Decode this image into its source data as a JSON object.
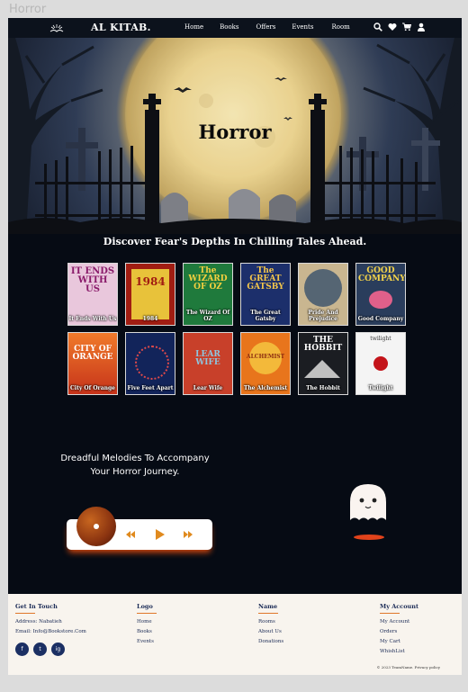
{
  "window_title": "Horror",
  "navbar": {
    "brand": "AL KITAB.",
    "links": [
      "Home",
      "Books",
      "Offers",
      "Events",
      "Room"
    ],
    "icons": [
      "search-icon",
      "heart-icon",
      "cart-icon",
      "user-icon"
    ]
  },
  "hero": {
    "title": "Horror"
  },
  "subtitle": "Discover Fear's Depths In Chilling Tales Ahead.",
  "books": [
    {
      "title": "It Ends With Us",
      "cover_text": "IT ENDS WITH US"
    },
    {
      "title": "1984",
      "cover_text": "1984"
    },
    {
      "title": "The Wizard Of OZ",
      "cover_text": "The WIZARD OF OZ"
    },
    {
      "title": "The Great Gatsby",
      "cover_text": "The GREAT GATSBY"
    },
    {
      "title": "Pride And Prejudice",
      "cover_text": ""
    },
    {
      "title": "Good Company",
      "cover_text": "GOOD COMPANY"
    },
    {
      "title": "City Of Orange",
      "cover_text": "CITY OF ORANGE"
    },
    {
      "title": "Five Feet Apart",
      "cover_text": ""
    },
    {
      "title": "Lear Wife",
      "cover_text": "LEAR WIFE"
    },
    {
      "title": "The Alchemist",
      "cover_text": "ALCHEMIST"
    },
    {
      "title": "The Hobbit",
      "cover_text": "THE HOBBIT"
    },
    {
      "title": "Twilight",
      "cover_text": "twilight"
    }
  ],
  "music": {
    "heading": "Dreadful Melodies To Accompany Your Horror Journey."
  },
  "footer": {
    "col1": {
      "title": "Get In Touch",
      "address": "Address: Nabatieh",
      "email": "Email: Info@Bookstore.Com"
    },
    "col2": {
      "title": "Logo",
      "items": [
        "Home",
        "Books",
        "Events"
      ]
    },
    "col3": {
      "title": "Name",
      "items": [
        "Rooms",
        "About Us",
        "Donations"
      ]
    },
    "col4": {
      "title": "My Account",
      "items": [
        "My Account",
        "Orders",
        "My Cart",
        "WhishList"
      ]
    },
    "social": [
      "f",
      "t",
      "ig"
    ],
    "copyright": "© 2023 TeamName. Privacy policy"
  },
  "colors": {
    "accent": "#e0772a",
    "footer_text": "#1a2a55",
    "page_bg": "#060b14"
  }
}
